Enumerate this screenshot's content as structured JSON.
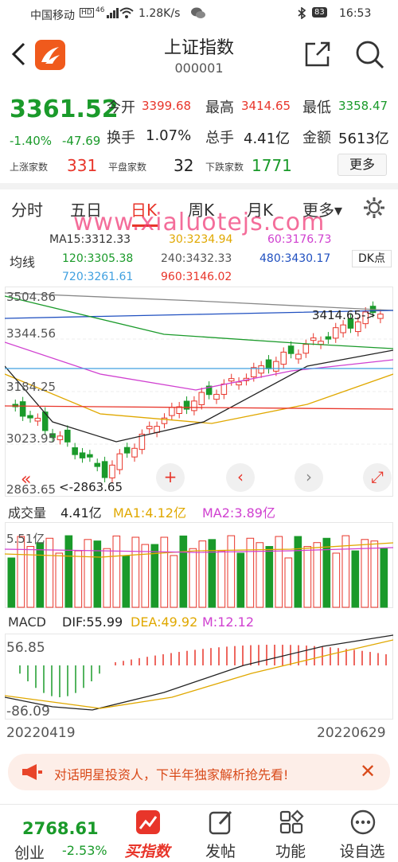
{
  "status": {
    "carrier": "中国移动",
    "hd": "HD",
    "net": "46",
    "speed": "1.28K/s",
    "battery": "83",
    "time": "16:53"
  },
  "header": {
    "back_icon": "chevron-left-icon",
    "logo_icon": "app-logo-icon",
    "title": "上证指数",
    "code": "000001",
    "share_icon": "share-icon",
    "search_icon": "search-icon"
  },
  "quote": {
    "price": "3361.52",
    "change_pct": "-1.40%",
    "change": "-47.69",
    "open_label": "今开",
    "open": "3399.68",
    "high_label": "最高",
    "high": "3414.65",
    "low_label": "最低",
    "low": "3358.47",
    "turnover_label": "换手",
    "turnover": "1.07%",
    "volume_label": "总手",
    "volume": "4.41亿",
    "amount_label": "金额",
    "amount": "5613亿",
    "up_label": "上涨家数",
    "up": "331",
    "flat_label": "平盘家数",
    "flat": "32",
    "down_label": "下跌家数",
    "down": "1771",
    "more": "更多",
    "colors": {
      "up": "#e8352a",
      "down": "#1a9a2a"
    }
  },
  "tabs": [
    {
      "label": "分时"
    },
    {
      "label": "五日"
    },
    {
      "label": "日K",
      "active": true
    },
    {
      "label": "周K"
    },
    {
      "label": "月K"
    },
    {
      "label": "更多▾"
    }
  ],
  "watermark": "www.xialuotejs.com",
  "ma": {
    "title": "均线",
    "ma15": "MA15:3312.33",
    "ma30": "30:3234.94",
    "ma60": "60:3176.73",
    "ma120": "120:3305.38",
    "ma240": "240:3432.33",
    "ma480": "480:3430.17",
    "ma720": "720:3261.61",
    "ma960": "960:3146.02",
    "dk": "DK点"
  },
  "chart_data": [
    {
      "type": "candlestick",
      "y_ticks": [
        "3504.86",
        "3344.56",
        "3184.25",
        "3023.95",
        "2863.65"
      ],
      "annotations": [
        "3414.65->",
        "<-2863.65"
      ],
      "x_range": [
        "20220419",
        "20220629"
      ]
    },
    {
      "type": "bar",
      "title": "成交量",
      "legend": [
        "4.41亿",
        "MA1:4.12亿",
        "MA2:3.89亿"
      ],
      "y_ticks": [
        "5.51亿"
      ]
    },
    {
      "type": "bar",
      "title": "MACD",
      "legend": [
        "DIF:55.99",
        "DEA:49.92",
        "M:12.12"
      ],
      "y_ticks": [
        "56.85",
        "-86.09"
      ]
    }
  ],
  "dates": {
    "start": "20220419",
    "end": "20220629"
  },
  "ad": {
    "text": "对话明星投资人，下半年独家解析抢先看!",
    "close": "✕"
  },
  "nav": {
    "index_value": "2768.61",
    "index_name": "创业",
    "index_change": "-2.53%",
    "buy_index": "买指数",
    "post": "发帖",
    "functions": "功能",
    "watchlist": "设自选"
  }
}
